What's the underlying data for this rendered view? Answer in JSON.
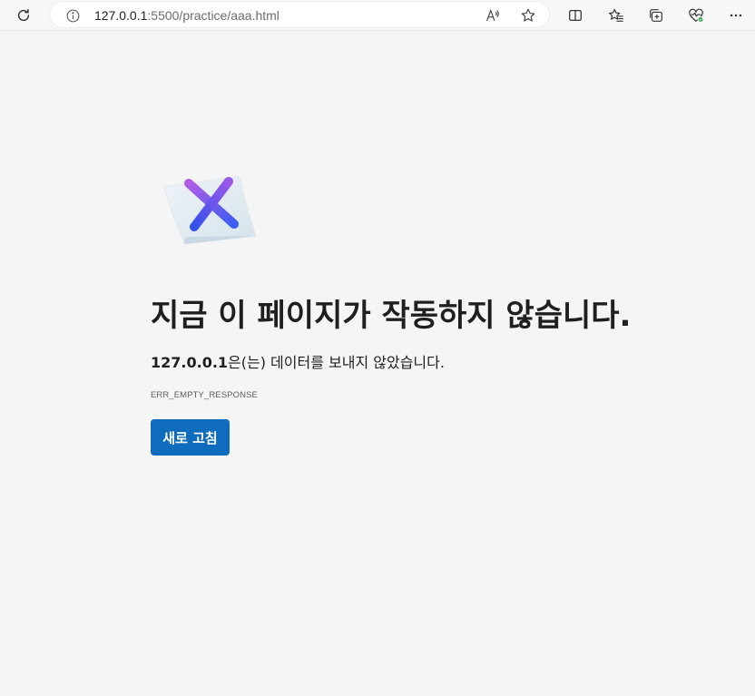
{
  "browser": {
    "url_host": "127.0.0.1",
    "url_path": ":5500/practice/aaa.html",
    "toolbar_icons": [
      "refresh-icon",
      "site-info-icon",
      "read-aloud-icon",
      "add-favorite-icon",
      "split-screen-icon",
      "favorites-icon",
      "collections-icon",
      "browser-essentials-icon",
      "more-icon"
    ]
  },
  "error_page": {
    "title": "지금 이 페이지가 작동하지 않습니다.",
    "host": "127.0.0.1",
    "description_rest": "은(는) 데이터를 보내지 않았습니다.",
    "error_code": "ERR_EMPTY_RESPONSE",
    "reload_label": "새로 고침"
  },
  "colors": {
    "page_bg": "#f5f5f5",
    "button_bg": "#0f6cbd",
    "icon_x_start": "#a45be8",
    "icon_x_end": "#3a5bf0"
  }
}
